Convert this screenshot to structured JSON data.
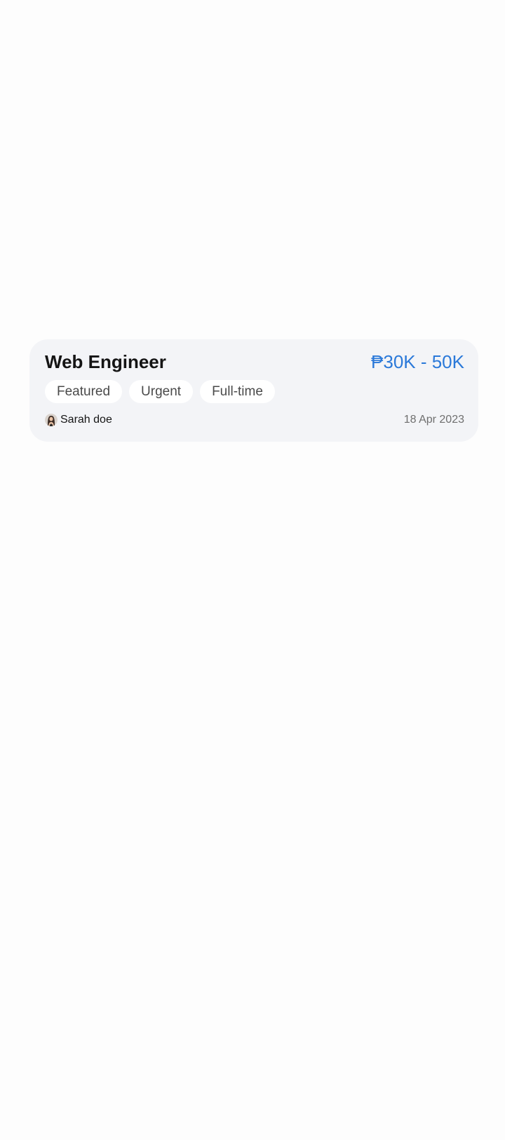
{
  "job": {
    "title": "Web Engineer",
    "salary": "₱30K - 50K",
    "tags": [
      "Featured",
      "Urgent",
      "Full-time"
    ],
    "poster": {
      "name": "Sarah doe",
      "avatar_icon": "user-avatar"
    },
    "date": "18 Apr 2023"
  },
  "colors": {
    "background": "#fdfdfd",
    "card_background": "#f3f4f7",
    "salary_accent": "#2b79d9",
    "tag_background": "#ffffff"
  }
}
